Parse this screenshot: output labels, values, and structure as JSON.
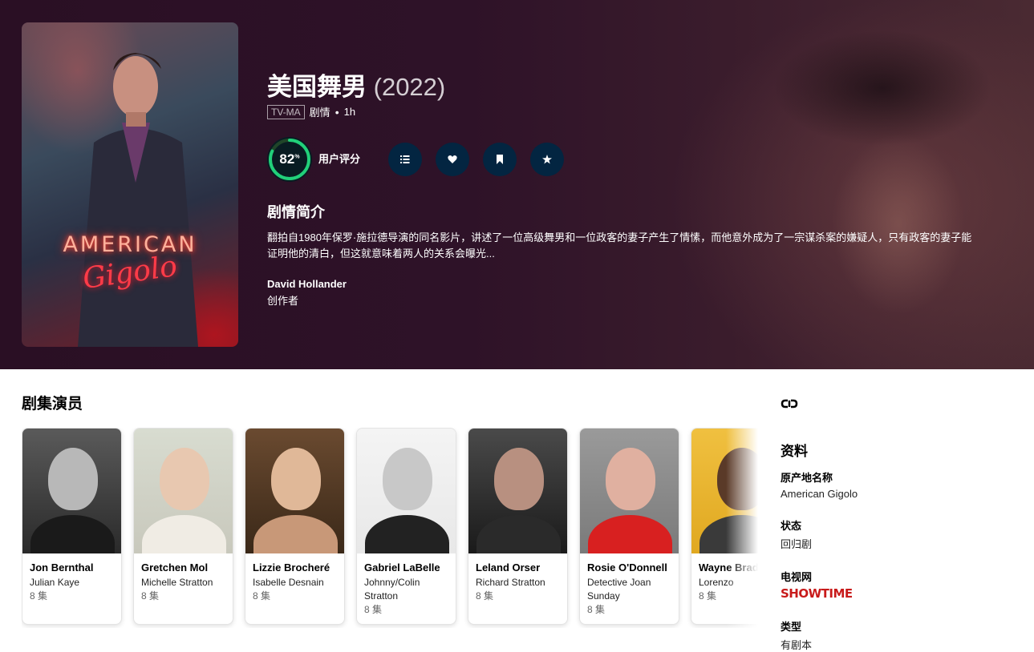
{
  "show": {
    "title": "美国舞男",
    "year": "(2022)",
    "certification": "TV-MA",
    "genre": "剧情",
    "runtime": "1h",
    "score": "82",
    "score_percent": 0.82,
    "score_label": "用户评分",
    "overview_heading": "剧情简介",
    "overview": "翻拍自1980年保罗·施拉德导演的同名影片，讲述了一位高级舞男和一位政客的妻子产生了情愫，而他意外成为了一宗谋杀案的嫌疑人，只有政客的妻子能证明他的清白，但这就意味着两人的关系会曝光...",
    "creator_name": "David Hollander",
    "creator_role": "创作者",
    "poster_title": "AMERICAN",
    "poster_subtitle": "Gigolo"
  },
  "actions": [
    {
      "name": "add-to-list",
      "icon": "list-icon"
    },
    {
      "name": "favorite",
      "icon": "heart-icon"
    },
    {
      "name": "watchlist",
      "icon": "bookmark-icon"
    },
    {
      "name": "rate",
      "icon": "star-icon"
    }
  ],
  "cast_heading": "剧集演员",
  "cast": [
    {
      "name": "Jon Bernthal",
      "character": "Julian Kaye",
      "episodes": "8 集"
    },
    {
      "name": "Gretchen Mol",
      "character": "Michelle Stratton",
      "episodes": "8 集"
    },
    {
      "name": "Lizzie Brocheré",
      "character": "Isabelle Desnain",
      "episodes": "8 集"
    },
    {
      "name": "Gabriel LaBelle",
      "character": "Johnny/Colin Stratton",
      "episodes": "8 集"
    },
    {
      "name": "Leland Orser",
      "character": "Richard Stratton",
      "episodes": "8 集"
    },
    {
      "name": "Rosie O'Donnell",
      "character": "Detective Joan Sunday",
      "episodes": "8 集"
    },
    {
      "name": "Wayne Brady",
      "character": "Lorenzo",
      "episodes": "8 集"
    }
  ],
  "sidebar": {
    "facts_heading": "资料",
    "original_name_label": "原产地名称",
    "original_name": "American Gigolo",
    "status_label": "状态",
    "status": "回归剧",
    "network_label": "电视网",
    "network": "SHOWTIME",
    "type_label": "类型",
    "type": "有剧本"
  },
  "colors": {
    "score_ring": "#21d07a",
    "action_bg": "#032541",
    "network_red": "#c81a1a"
  }
}
